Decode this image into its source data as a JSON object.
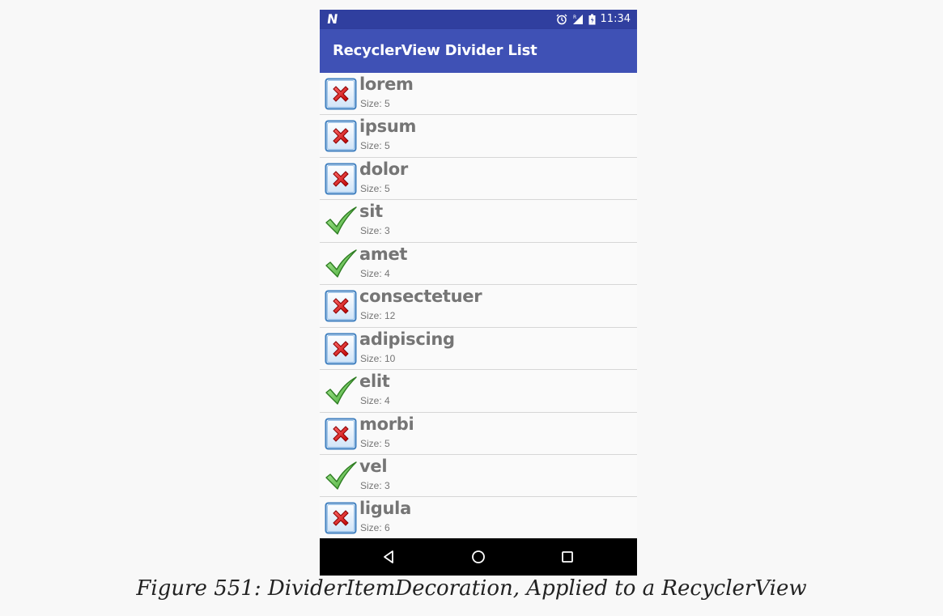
{
  "status_bar": {
    "time": "11:34",
    "left_icon": "n-notification-icon"
  },
  "app_bar": {
    "title": "RecyclerView Divider List"
  },
  "items": [
    {
      "word": "lorem",
      "size": "Size: 5",
      "icon": "cross-icon"
    },
    {
      "word": "ipsum",
      "size": "Size: 5",
      "icon": "cross-icon"
    },
    {
      "word": "dolor",
      "size": "Size: 5",
      "icon": "cross-icon"
    },
    {
      "word": "sit",
      "size": "Size: 3",
      "icon": "check-icon"
    },
    {
      "word": "amet",
      "size": "Size: 4",
      "icon": "check-icon"
    },
    {
      "word": "consectetuer",
      "size": "Size: 12",
      "icon": "cross-icon"
    },
    {
      "word": "adipiscing",
      "size": "Size: 10",
      "icon": "cross-icon"
    },
    {
      "word": "elit",
      "size": "Size: 4",
      "icon": "check-icon"
    },
    {
      "word": "morbi",
      "size": "Size: 5",
      "icon": "cross-icon"
    },
    {
      "word": "vel",
      "size": "Size: 3",
      "icon": "check-icon"
    },
    {
      "word": "ligula",
      "size": "Size: 6",
      "icon": "cross-icon"
    }
  ],
  "nav_bar": {
    "buttons": [
      "back-icon",
      "home-icon",
      "recents-icon"
    ]
  },
  "caption": "Figure 551: DividerItemDecoration, Applied to a RecyclerView",
  "colors": {
    "status_bar": "#303f9f",
    "app_bar": "#3f51b5",
    "nav_bar": "#000000",
    "check": "#4caf50",
    "cross": "#e53935"
  }
}
